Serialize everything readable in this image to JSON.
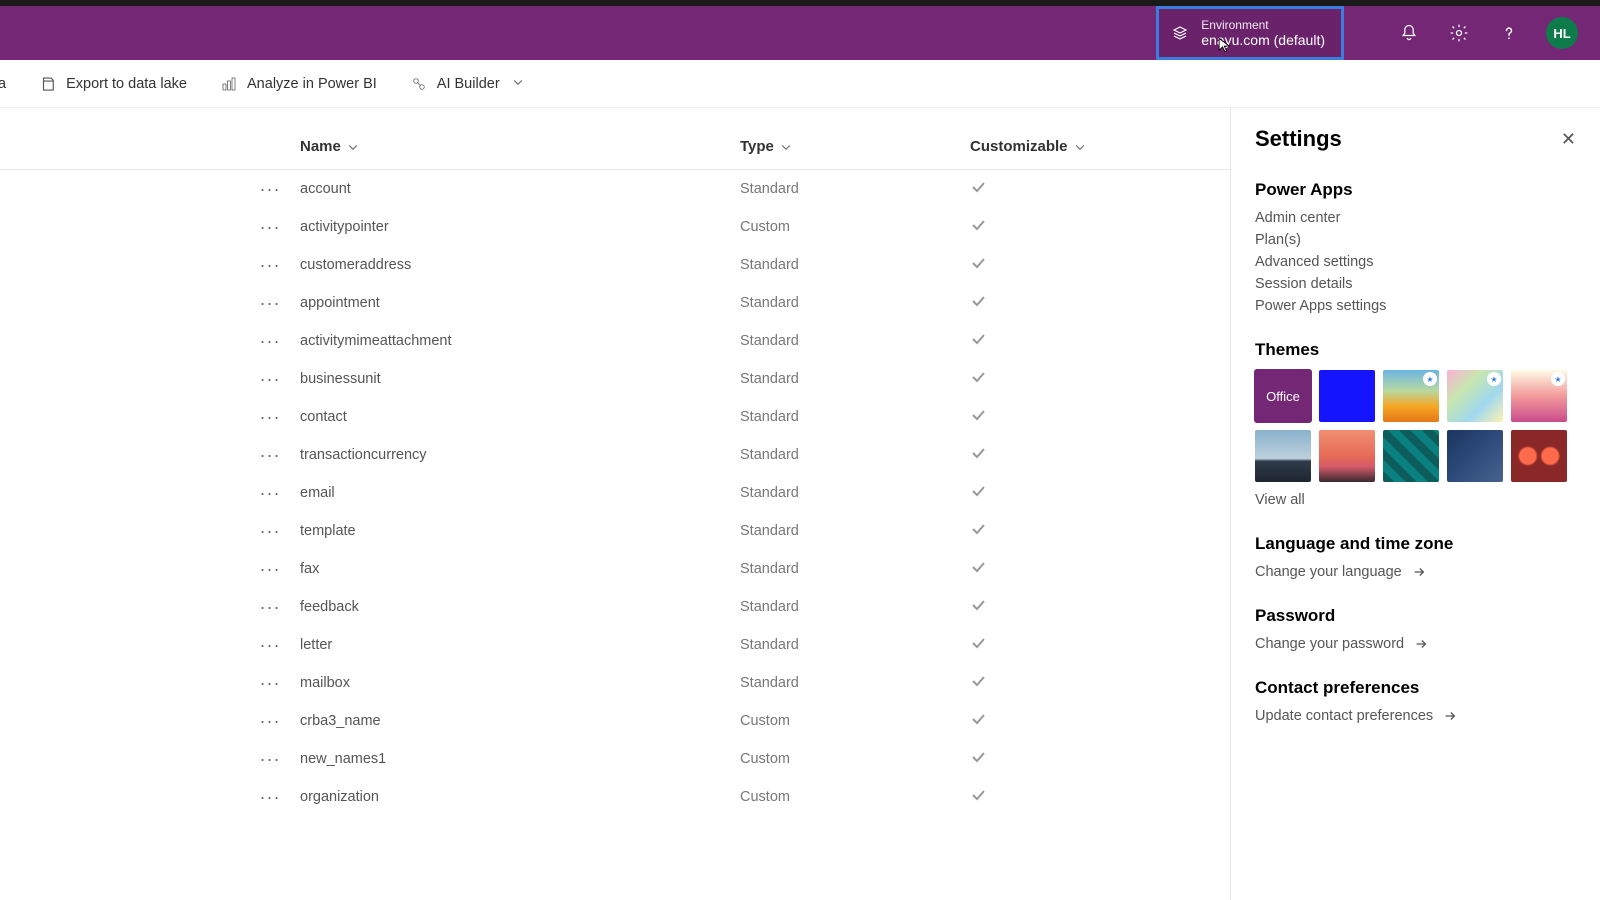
{
  "header": {
    "environment_label": "Environment",
    "environment_value": "enayu.com (default)",
    "avatar_initials": "HL"
  },
  "toolbar": {
    "items": [
      {
        "label": "ta"
      },
      {
        "label": "Export to data lake"
      },
      {
        "label": "Analyze in Power BI"
      },
      {
        "label": "AI Builder"
      }
    ]
  },
  "table": {
    "columns": {
      "name": "Name",
      "type": "Type",
      "customizable": "Customizable"
    },
    "rows": [
      {
        "name": "account",
        "type": "Standard",
        "customizable": true
      },
      {
        "name": "activitypointer",
        "type": "Custom",
        "customizable": true
      },
      {
        "name": "customeraddress",
        "type": "Standard",
        "customizable": true
      },
      {
        "name": "appointment",
        "type": "Standard",
        "customizable": true
      },
      {
        "name": "activitymimeattachment",
        "type": "Standard",
        "customizable": true
      },
      {
        "name": "businessunit",
        "type": "Standard",
        "customizable": true
      },
      {
        "name": "contact",
        "type": "Standard",
        "customizable": true
      },
      {
        "name": "transactioncurrency",
        "type": "Standard",
        "customizable": true
      },
      {
        "name": "email",
        "type": "Standard",
        "customizable": true
      },
      {
        "name": "template",
        "type": "Standard",
        "customizable": true
      },
      {
        "name": "fax",
        "type": "Standard",
        "customizable": true
      },
      {
        "name": "feedback",
        "type": "Standard",
        "customizable": true
      },
      {
        "name": "letter",
        "type": "Standard",
        "customizable": true
      },
      {
        "name": "mailbox",
        "type": "Standard",
        "customizable": true
      },
      {
        "name": "crba3_name",
        "type": "Custom",
        "customizable": true
      },
      {
        "name": "new_names1",
        "type": "Custom",
        "customizable": true
      },
      {
        "name": "organization",
        "type": "Custom",
        "customizable": true
      }
    ]
  },
  "settings": {
    "title": "Settings",
    "powerapps_heading": "Power Apps",
    "links": [
      "Admin center",
      "Plan(s)",
      "Advanced settings",
      "Session details",
      "Power Apps settings"
    ],
    "themes_heading": "Themes",
    "office_label": "Office",
    "view_all": "View all",
    "lang_heading": "Language and time zone",
    "lang_link": "Change your language",
    "password_heading": "Password",
    "password_link": "Change your password",
    "contact_heading": "Contact preferences",
    "contact_link": "Update contact preferences"
  }
}
